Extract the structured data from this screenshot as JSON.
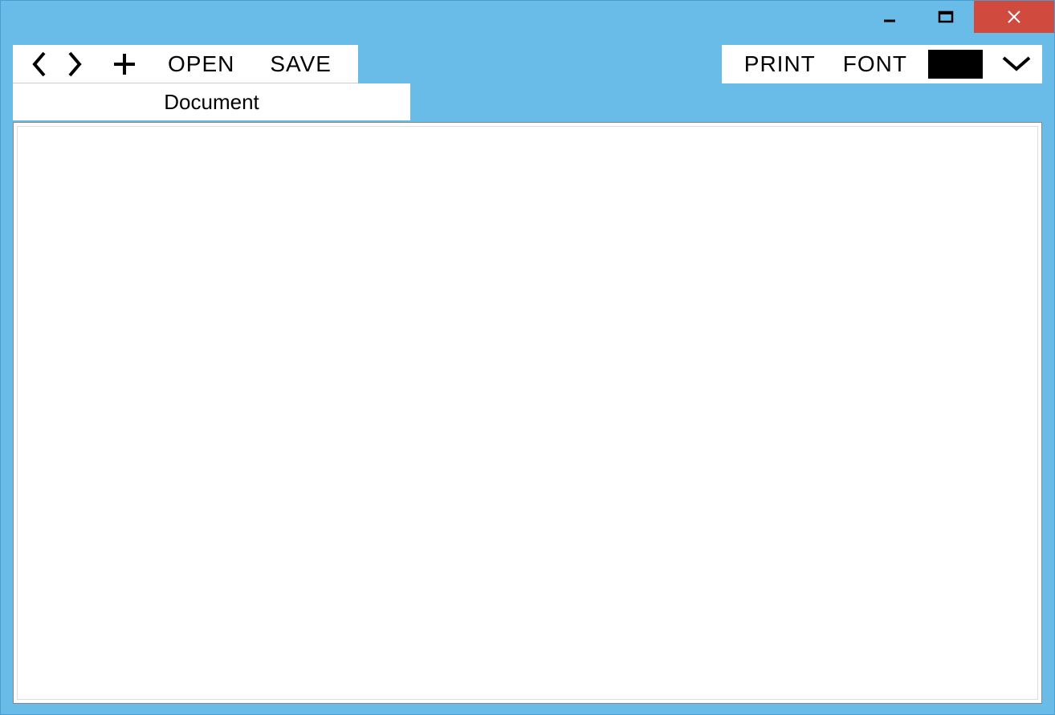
{
  "titlebar": {
    "minimize": "minimize",
    "maximize": "maximize",
    "close": "close"
  },
  "toolbar": {
    "left": {
      "back": "back",
      "forward": "forward",
      "add": "add",
      "open_label": "OPEN",
      "save_label": "SAVE"
    },
    "right": {
      "print_label": "PRINT",
      "font_label": "FONT",
      "color_value": "#000000",
      "dropdown": "dropdown"
    }
  },
  "tabs": [
    {
      "label": "Document"
    }
  ],
  "content": {
    "text": ""
  }
}
